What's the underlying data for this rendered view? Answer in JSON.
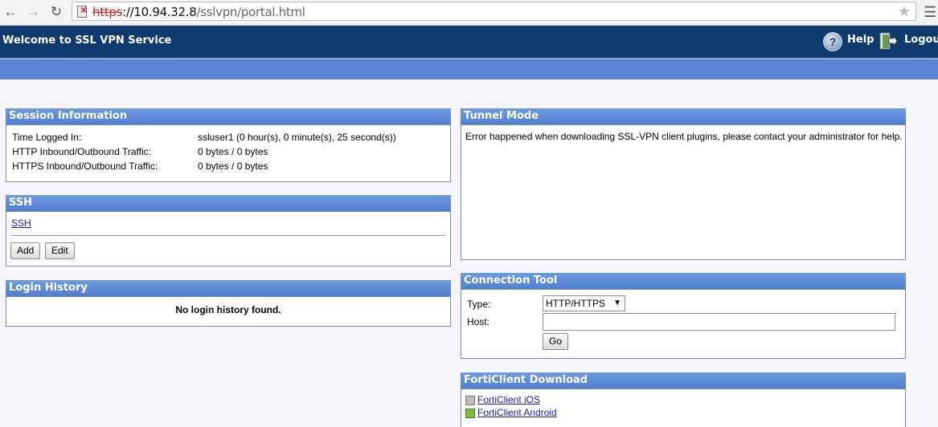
{
  "browser": {
    "url_scheme": "https",
    "url_host": "://10.94.32.8",
    "url_path": "/sslvpn/portal.html"
  },
  "header": {
    "title": "Welcome to SSL VPN Service",
    "help": "Help",
    "logout": "Logout"
  },
  "session": {
    "title": "Session Information",
    "rows": [
      {
        "label": "Time Logged In:",
        "value": "ssluser1 (0 hour(s), 0 minute(s), 25 second(s))"
      },
      {
        "label": "HTTP Inbound/Outbound Traffic:",
        "value": "0 bytes / 0 bytes"
      },
      {
        "label": "HTTPS Inbound/Outbound Traffic:",
        "value": "0 bytes / 0 bytes"
      }
    ]
  },
  "ssh": {
    "title": "SSH",
    "link": "SSH",
    "add": "Add",
    "edit": "Edit"
  },
  "login_history": {
    "title": "Login History",
    "empty": "No login history found."
  },
  "tunnel": {
    "title": "Tunnel Mode",
    "message": "Error happened when downloading SSL-VPN client plugins, please contact your administrator for help."
  },
  "connection_tool": {
    "title": "Connection Tool",
    "type_label": "Type:",
    "type_value": "HTTP/HTTPS",
    "host_label": "Host:",
    "host_value": "",
    "go": "Go"
  },
  "forticlient": {
    "title": "FortiClient Download",
    "links": [
      "FortiClient iOS",
      "FortiClient Android"
    ]
  },
  "colors": {
    "header_bg": "#0e3a6e",
    "band": "#5b87d6",
    "panel_head": "#5a88d6"
  }
}
